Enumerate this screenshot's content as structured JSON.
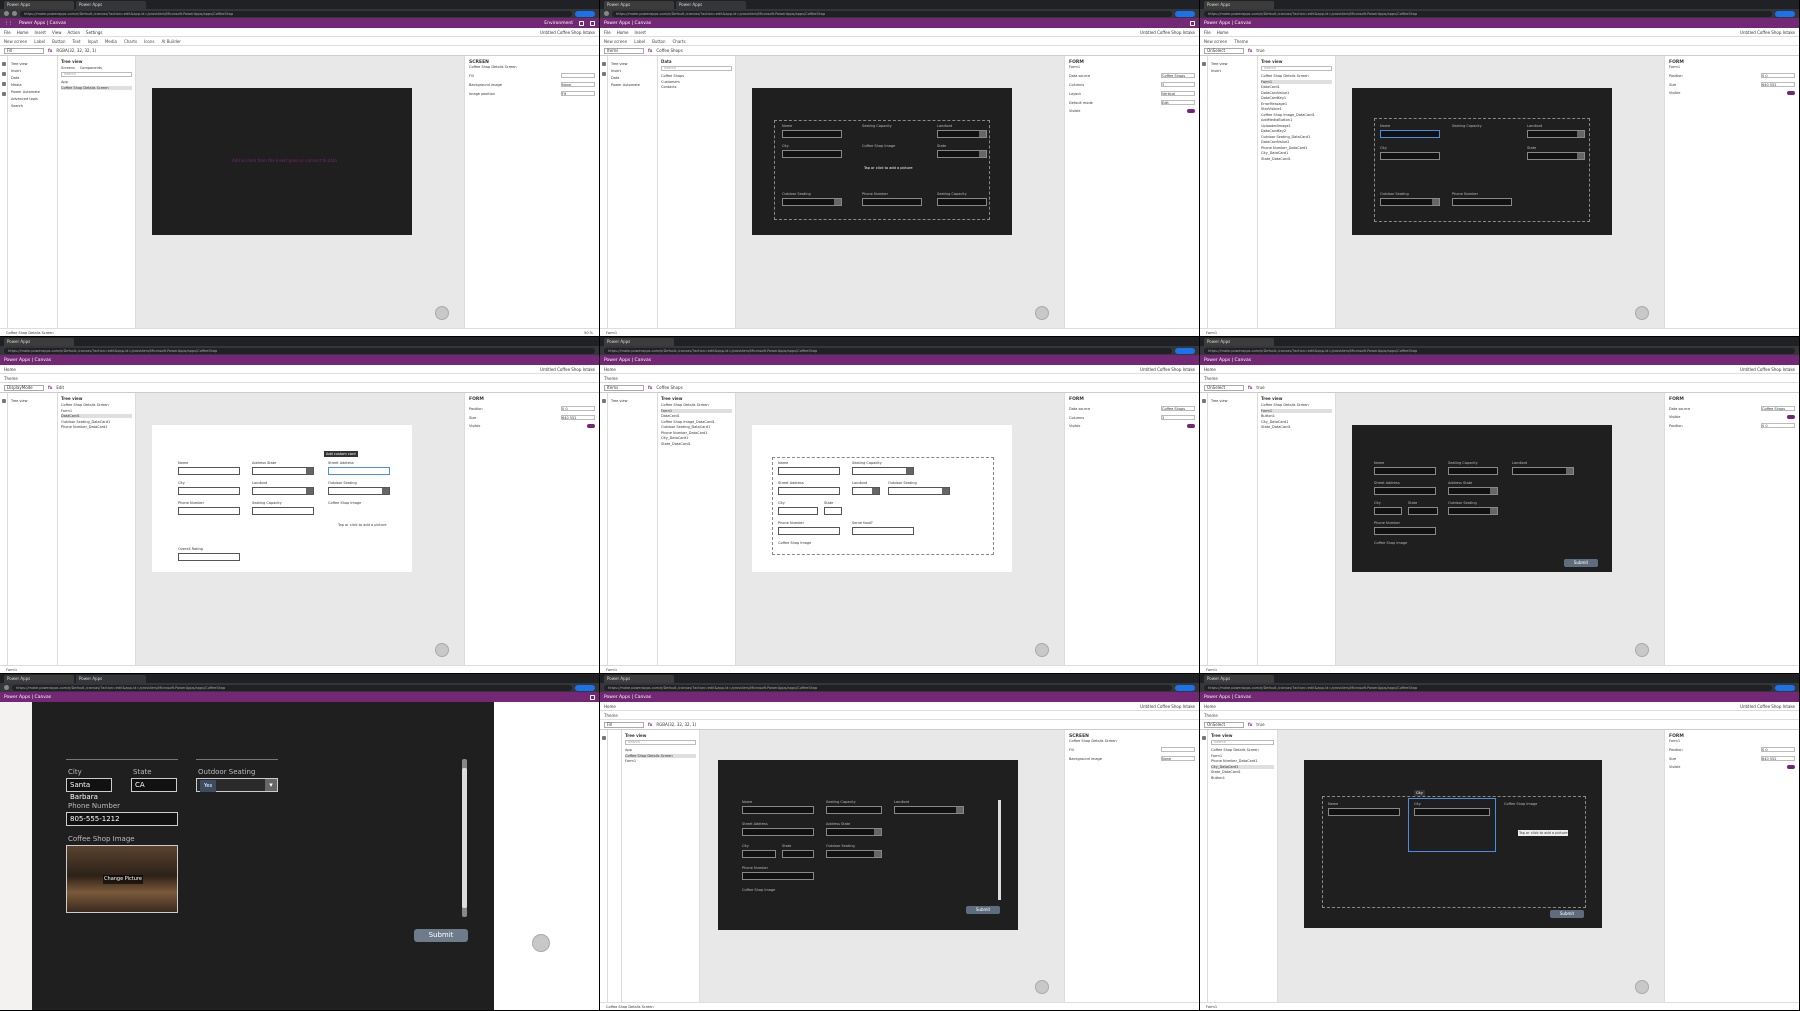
{
  "browser": {
    "tab_active": "Power Apps",
    "tab_other": "Power Apps",
    "url": "https://make.powerapps.com/e/Default-/canvas/?action=edit&app-id=/providers/Microsoft.PowerApps/apps/CoffeeShop"
  },
  "app": {
    "brand": "Power Apps | Canvas",
    "env": "Environment",
    "app_name": "Untitled Coffee Shop Intake"
  },
  "menu": {
    "items": [
      "File",
      "Home",
      "Insert",
      "View",
      "Action",
      "Settings"
    ]
  },
  "commands": {
    "items": [
      "New screen",
      "Theme",
      "Label",
      "Button",
      "Text",
      "Input",
      "Media",
      "Charts",
      "Icons",
      "AI Builder",
      "Data"
    ]
  },
  "formula": {
    "fill": {
      "property": "Fill",
      "value": "RGBA(32, 32, 32, 1)"
    },
    "coffee_shops": {
      "property": "Items",
      "value": "Coffee Shops"
    },
    "onselect": {
      "property": "OnSelect",
      "value": "true"
    },
    "default": {
      "property": "DisplayMode",
      "value": "Edit"
    }
  },
  "side": {
    "items": [
      "Tree view",
      "Insert",
      "Data",
      "Media",
      "Power Automate",
      "Advanced tools",
      "Search"
    ]
  },
  "tree": {
    "title": "Tree view",
    "tab_screens": "Screens",
    "tab_components": "Components",
    "search": "Search",
    "app": "App",
    "screen": "Coffee Shop Details Screen",
    "nodes": [
      "Form1",
      "DataCard1",
      "DataCardValue1",
      "DataCardKey1",
      "ErrorMessage1",
      "StarVisible1",
      "Coffee Shop Image_DataCard1",
      "AddMediaButton1",
      "UploadedImage1",
      "DataCardKey2",
      "Outdoor Seating_DataCard1",
      "DataCardValue2",
      "Phone Number_DataCard1",
      "City_DataCard1",
      "State_DataCard1",
      "Button1"
    ],
    "selected": "Form1"
  },
  "data_pane": {
    "title": "Data",
    "search": "Search",
    "items": [
      "Coffee Shops",
      "Customers",
      "Contacts"
    ]
  },
  "props": {
    "title_screen": "SCREEN",
    "title_form": "FORM",
    "name_screen": "Coffee Shop Details Screen",
    "name_form": "Form1",
    "tabs": [
      "Properties",
      "Advanced",
      "Ideas"
    ],
    "rows": [
      {
        "k": "Fill",
        "v": ""
      },
      {
        "k": "Background image",
        "v": "None"
      },
      {
        "k": "Image position",
        "v": "Fit"
      },
      {
        "k": "Data source",
        "v": "Coffee Shops"
      },
      {
        "k": "Columns",
        "v": "3"
      },
      {
        "k": "Layout",
        "v": "Vertical"
      },
      {
        "k": "Default mode",
        "v": "Edit"
      },
      {
        "k": "Visible",
        "v": ""
      },
      {
        "k": "Position",
        "v": "0  0"
      },
      {
        "k": "Size",
        "v": "640  552"
      }
    ]
  },
  "status": {
    "screen_label": "Coffee Shop Details Screen",
    "form_label": "Form1",
    "zoom": "50 %"
  },
  "form": {
    "fields": {
      "name": "Name",
      "seating_capacity": "Seating Capacity",
      "landlord": "Landlord",
      "street_address": "Street Address",
      "address_state": "Address State",
      "city": "City",
      "state": "State",
      "outdoor_seating": "Outdoor Seating",
      "phone_number": "Phone Number",
      "coffee_shop_image": "Coffee Shop Image",
      "overall_rating": "Overall Rating",
      "serve_food": "Serve food?"
    },
    "add_item_hint": "Add an item from the Insert pane or connect to data",
    "tap_hint": "Tap or click to add a picture",
    "submit": "Submit",
    "add_custom_card": "Add custom card"
  },
  "zoomed": {
    "city_label": "City",
    "city_value": "Santa Barbara",
    "state_label": "State",
    "state_value": "CA",
    "outdoor_label": "Outdoor Seating",
    "outdoor_value": "Yes",
    "phone_label": "Phone Number",
    "phone_value": "805-555-1212",
    "image_label": "Coffee Shop Image",
    "change_picture": "Change Picture",
    "submit": "Submit"
  }
}
